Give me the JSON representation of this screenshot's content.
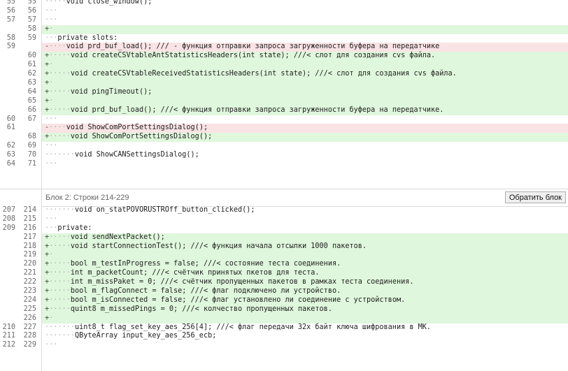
{
  "block1": {
    "rows": [
      {
        "old": "55",
        "new": "55",
        "type": "ctx",
        "marker": "",
        "lead": "·····",
        "text": "void close_window();"
      },
      {
        "old": "56",
        "new": "56",
        "type": "ctx",
        "marker": "",
        "lead": "···",
        "text": ""
      },
      {
        "old": "57",
        "new": "57",
        "type": "ctx",
        "marker": "",
        "lead": "···",
        "text": ""
      },
      {
        "old": "",
        "new": "58",
        "type": "add",
        "marker": "+",
        "lead": "·",
        "text": ""
      },
      {
        "old": "58",
        "new": "59",
        "type": "ctx",
        "marker": "",
        "lead": "···",
        "text": "private slots:"
      },
      {
        "old": "59",
        "new": "",
        "type": "del",
        "marker": "-",
        "lead": "····",
        "text": "void prd_buf_load(); /// - функция отправки запроса загруженности буфера на передатчике"
      },
      {
        "old": "",
        "new": "60",
        "type": "add",
        "marker": "+",
        "lead": "·····",
        "text": "void createCSVtableAntStatisticsHeaders(int state); ///< слот для создания cvs файла."
      },
      {
        "old": "",
        "new": "61",
        "type": "add",
        "marker": "+",
        "lead": "·",
        "text": ""
      },
      {
        "old": "",
        "new": "62",
        "type": "add",
        "marker": "+",
        "lead": "·····",
        "text": "void createCSVtableReceivedStatisticsHeaders(int state); ///< слот для создания cvs файла."
      },
      {
        "old": "",
        "new": "63",
        "type": "add",
        "marker": "+",
        "lead": "·",
        "text": ""
      },
      {
        "old": "",
        "new": "64",
        "type": "add",
        "marker": "+",
        "lead": "·····",
        "text": "void pingTimeout();"
      },
      {
        "old": "",
        "new": "65",
        "type": "add",
        "marker": "+",
        "lead": "·",
        "text": ""
      },
      {
        "old": "",
        "new": "66",
        "type": "add",
        "marker": "+",
        "lead": "·····",
        "text": "void prd_buf_load(); ///< функция отправки запроса загруженности буфера на передатчике."
      },
      {
        "old": "60",
        "new": "67",
        "type": "ctx",
        "marker": "",
        "lead": "···",
        "text": ""
      },
      {
        "old": "61",
        "new": "",
        "type": "del",
        "marker": "-",
        "lead": "····",
        "text": "void ShowComPortSettingsDialog();"
      },
      {
        "old": "",
        "new": "68",
        "type": "add",
        "marker": "+",
        "lead": "·····",
        "text": "void ShowComPortSettingsDialog();"
      },
      {
        "old": "62",
        "new": "69",
        "type": "ctx",
        "marker": "",
        "lead": "···",
        "text": ""
      },
      {
        "old": "63",
        "new": "70",
        "type": "ctx",
        "marker": "",
        "lead": "·······",
        "text": "void ShowCANSettingsDialog();"
      },
      {
        "old": "64",
        "new": "71",
        "type": "ctx",
        "marker": "",
        "lead": "···",
        "text": ""
      }
    ]
  },
  "hunk2": {
    "title": "Блок 2: Строки 214-229",
    "revert_label": "Обратить блок"
  },
  "block2": {
    "rows": [
      {
        "old": "207",
        "new": "214",
        "type": "ctx",
        "marker": "",
        "lead": "·······",
        "text": "void on_statPOVORUSTROff_button_clicked();"
      },
      {
        "old": "208",
        "new": "215",
        "type": "ctx",
        "marker": "",
        "lead": "···",
        "text": ""
      },
      {
        "old": "209",
        "new": "216",
        "type": "ctx",
        "marker": "",
        "lead": "···",
        "text": "private:"
      },
      {
        "old": "",
        "new": "217",
        "type": "add",
        "marker": "+",
        "lead": "·····",
        "text": "void sendNextPacket();"
      },
      {
        "old": "",
        "new": "218",
        "type": "add",
        "marker": "+",
        "lead": "·····",
        "text": "void startConnectionTest(); ///< функция начала отсылки 1000 пакетов."
      },
      {
        "old": "",
        "new": "219",
        "type": "add",
        "marker": "+",
        "lead": "·",
        "text": ""
      },
      {
        "old": "",
        "new": "220",
        "type": "add",
        "marker": "+",
        "lead": "·····",
        "text": "bool m_testInProgress = false; ///< состояние теста соединения."
      },
      {
        "old": "",
        "new": "221",
        "type": "add",
        "marker": "+",
        "lead": "·····",
        "text": "int m_packetCount; ///< счётчик принятых пкетов для теста."
      },
      {
        "old": "",
        "new": "222",
        "type": "add",
        "marker": "+",
        "lead": "·····",
        "text": "int m_missPaket = 0; ///< счётчик пропущенных пакетов в рамках теста соединения."
      },
      {
        "old": "",
        "new": "223",
        "type": "add",
        "marker": "+",
        "lead": "·····",
        "text": "bool m_flagConnect = false; ///< флаг подключено ли устройство."
      },
      {
        "old": "",
        "new": "224",
        "type": "add",
        "marker": "+",
        "lead": "·····",
        "text": "bool m_isConnected = false; ///< флаг установлено ли соединение с устройством."
      },
      {
        "old": "",
        "new": "225",
        "type": "add",
        "marker": "+",
        "lead": "·····",
        "text": "quint8 m_missedPings = 0; ///< колчество пропущенных пакетов."
      },
      {
        "old": "",
        "new": "226",
        "type": "add",
        "marker": "+",
        "lead": "·",
        "text": ""
      },
      {
        "old": "210",
        "new": "227",
        "type": "ctx",
        "marker": "",
        "lead": "·······",
        "text": "uint8_t flag_set_key_aes_256[4]; ///< флаг передачи 32х байт ключа шифрования в МК."
      },
      {
        "old": "211",
        "new": "228",
        "type": "ctx",
        "marker": "",
        "lead": "·······",
        "text": "QByteArray input_key_aes_256_ecb;"
      },
      {
        "old": "212",
        "new": "229",
        "type": "ctx",
        "marker": "",
        "lead": "···",
        "text": ""
      }
    ]
  }
}
